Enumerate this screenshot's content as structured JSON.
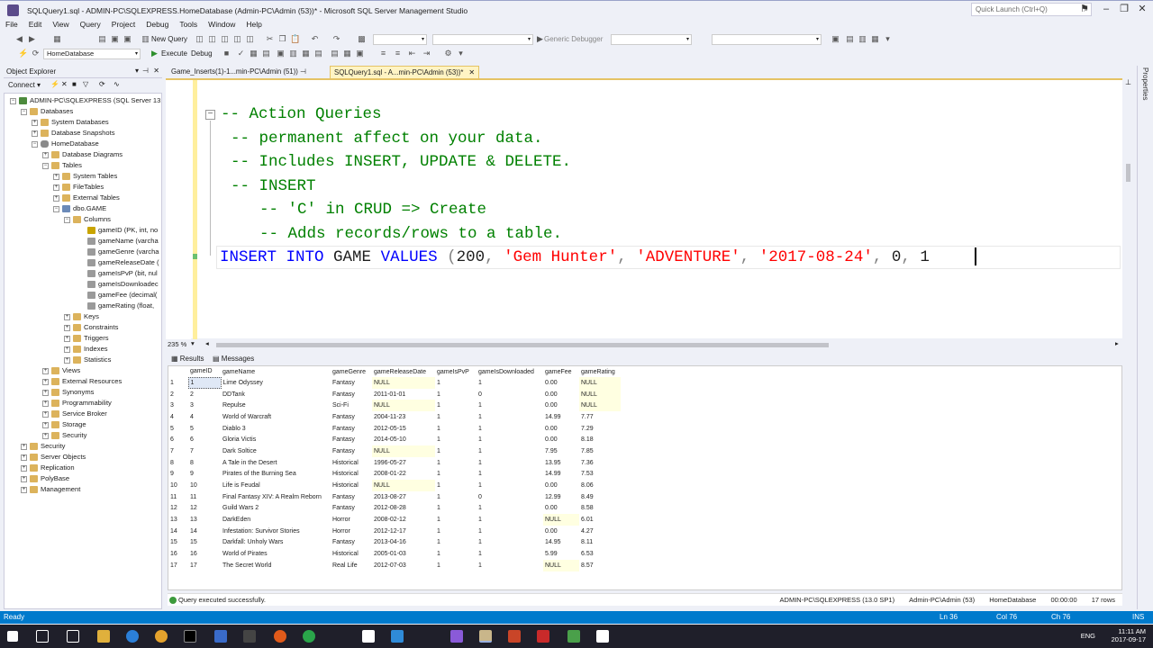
{
  "window": {
    "title": "SQLQuery1.sql - ADMIN-PC\\SQLEXPRESS.HomeDatabase (Admin-PC\\Admin (53))* - Microsoft SQL Server Management Studio",
    "quick_launch_placeholder": "Quick Launch (Ctrl+Q)"
  },
  "menu": [
    "File",
    "Edit",
    "View",
    "Query",
    "Project",
    "Debug",
    "Tools",
    "Window",
    "Help"
  ],
  "toolbar": {
    "new_query": "New Query",
    "database": "HomeDatabase",
    "execute": "Execute",
    "debug": "Debug",
    "debugger": "Generic Debugger"
  },
  "object_explorer": {
    "title": "Object Explorer",
    "connect": "Connect",
    "nodes": [
      "ADMIN-PC\\SQLEXPRESS (SQL Server 13.0",
      "Databases",
      "System Databases",
      "Database Snapshots",
      "HomeDatabase",
      "Database Diagrams",
      "Tables",
      "System Tables",
      "FileTables",
      "External Tables",
      "dbo.GAME",
      "Columns",
      "gameID (PK, int, no",
      "gameName (varcha",
      "gameGenre (varcha",
      "gameReleaseDate (",
      "gameIsPvP (bit, nul",
      "gameIsDownloadec",
      "gameFee (decimal(",
      "gameRating (float,",
      "Keys",
      "Constraints",
      "Triggers",
      "Indexes",
      "Statistics",
      "Views",
      "External Resources",
      "Synonyms",
      "Programmability",
      "Service Broker",
      "Storage",
      "Security",
      "Security",
      "Server Objects",
      "Replication",
      "PolyBase",
      "Management"
    ]
  },
  "tabs": {
    "tab1": "Game_Inserts(1)-1...min-PC\\Admin (51))",
    "tab2": "SQLQuery1.sql - A...min-PC\\Admin (53))*"
  },
  "editor": {
    "line1": "-- Action Queries",
    "line2": "-- permanent affect on your data.",
    "line3": "-- Includes INSERT, UPDATE & DELETE.",
    "line4": "-- INSERT",
    "line5": "-- 'C' in CRUD => Create",
    "line6": "-- Adds records/rows to a table.",
    "kw1": "INSERT INTO",
    "tbl": "GAME",
    "kw2": "VALUES",
    "open": "(",
    "v1": "200",
    "v2": "'Gem Hunter'",
    "v3": "'ADVENTURE'",
    "v4": "'2017-08-24'",
    "v5": "0",
    "v6": "1",
    "comma": ",",
    "zoom": "235 %"
  },
  "results": {
    "tab_results": "Results",
    "tab_messages": "Messages",
    "columns": [
      "gameID",
      "gameName",
      "gameGenre",
      "gameReleaseDate",
      "gameIsPvP",
      "gameIsDownloaded",
      "gameFee",
      "gameRating"
    ],
    "rows": [
      [
        "1",
        "1",
        "Lime Odyssey",
        "Fantasy",
        "NULL",
        "1",
        "1",
        "0.00",
        "NULL"
      ],
      [
        "2",
        "2",
        "DDTank",
        "Fantasy",
        "2011-01-01",
        "1",
        "0",
        "0.00",
        "NULL"
      ],
      [
        "3",
        "3",
        "Repulse",
        "Sci-Fi",
        "NULL",
        "1",
        "1",
        "0.00",
        "NULL"
      ],
      [
        "4",
        "4",
        "World of Warcraft",
        "Fantasy",
        "2004-11-23",
        "1",
        "1",
        "14.99",
        "7.77"
      ],
      [
        "5",
        "5",
        "Diablo 3",
        "Fantasy",
        "2012-05-15",
        "1",
        "1",
        "0.00",
        "7.29"
      ],
      [
        "6",
        "6",
        "Gloria Victis",
        "Fantasy",
        "2014-05-10",
        "1",
        "1",
        "0.00",
        "8.18"
      ],
      [
        "7",
        "7",
        "Dark Soltice",
        "Fantasy",
        "NULL",
        "1",
        "1",
        "7.95",
        "7.85"
      ],
      [
        "8",
        "8",
        "A Tale in the Desert",
        "Historical",
        "1996-05-27",
        "1",
        "1",
        "13.95",
        "7.36"
      ],
      [
        "9",
        "9",
        "Pirates of the Burning Sea",
        "Historical",
        "2008-01-22",
        "1",
        "1",
        "14.99",
        "7.53"
      ],
      [
        "10",
        "10",
        "Life is Feudal",
        "Historical",
        "NULL",
        "1",
        "1",
        "0.00",
        "8.06"
      ],
      [
        "11",
        "11",
        "Final Fantasy XIV: A Realm Reborn",
        "Fantasy",
        "2013-08-27",
        "1",
        "0",
        "12.99",
        "8.49"
      ],
      [
        "12",
        "12",
        "Guild Wars 2",
        "Fantasy",
        "2012-08-28",
        "1",
        "1",
        "0.00",
        "8.58"
      ],
      [
        "13",
        "13",
        "DarkEden",
        "Horror",
        "2008-02-12",
        "1",
        "1",
        "NULL",
        "6.01"
      ],
      [
        "14",
        "14",
        "Infestation: Survivor Stories",
        "Horror",
        "2012-12-17",
        "1",
        "1",
        "0.00",
        "4.27"
      ],
      [
        "15",
        "15",
        "Darkfall: Unholy Wars",
        "Fantasy",
        "2013-04-16",
        "1",
        "1",
        "14.95",
        "8.11"
      ],
      [
        "16",
        "16",
        "World of Pirates",
        "Historical",
        "2005-01-03",
        "1",
        "1",
        "5.99",
        "6.53"
      ],
      [
        "17",
        "17",
        "The Secret World",
        "Real Life",
        "2012-07-03",
        "1",
        "1",
        "NULL",
        "8.57"
      ]
    ]
  },
  "query_status": {
    "message": "Query executed successfully.",
    "server": "ADMIN-PC\\SQLEXPRESS (13.0 SP1)",
    "user": "Admin-PC\\Admin (53)",
    "database": "HomeDatabase",
    "elapsed": "00:00:00",
    "rows": "17 rows"
  },
  "app_status": {
    "ready": "Ready",
    "ln": "Ln 36",
    "col": "Col 76",
    "ch": "Ch 76",
    "ins": "INS"
  },
  "taskbar": {
    "lang": "ENG",
    "time": "11:11 AM",
    "date": "2017-09-17"
  },
  "right_panel": "Properties",
  "colors": {
    "accent": "#007acc",
    "comment": "#008000",
    "keyword": "#0000ff",
    "string": "#ff0000"
  }
}
